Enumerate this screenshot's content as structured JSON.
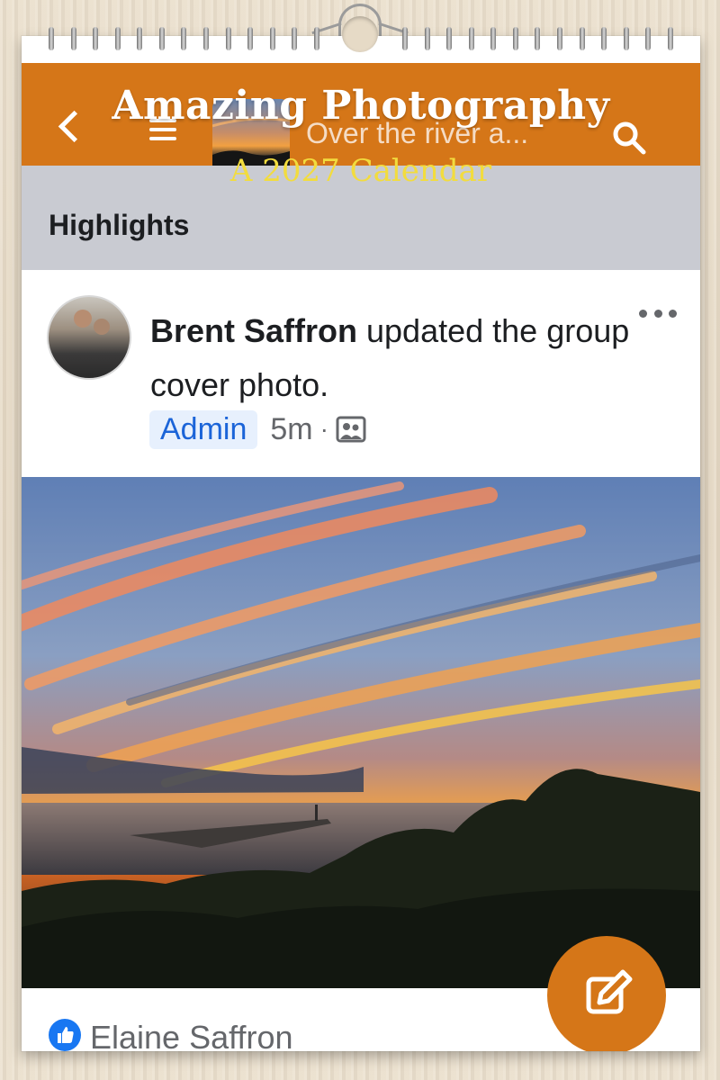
{
  "calendar": {
    "title": "Amazing Photography",
    "subtitle": "A 2027 Calendar"
  },
  "app_bar": {
    "group_name": "Over the river a...",
    "accent_color": "#d57618",
    "icons": [
      "chevron-left-icon",
      "menu-icon",
      "search-icon"
    ]
  },
  "section": {
    "label": "Highlights"
  },
  "post": {
    "author": "Brent Saffron",
    "action": " updated the group cover photo.",
    "badge": "Admin",
    "time": "5m",
    "separator": "·",
    "audience_icon": "group-icon",
    "more_icon": "more-options-icon"
  },
  "reactions": {
    "like_icon": "like-icon",
    "liker_name": "Elaine Saffron"
  },
  "fab": {
    "icon": "edit-icon"
  }
}
